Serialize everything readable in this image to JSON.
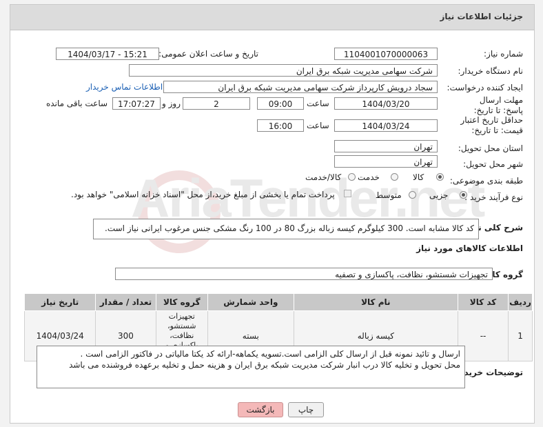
{
  "header": {
    "title": "جزئیات اطلاعات نیاز"
  },
  "watermark": "AriaTender.net",
  "fields": {
    "need_number_label": "شماره نیاز:",
    "need_number": "1104001070000063",
    "announce_label": "تاریخ و ساعت اعلان عمومی:",
    "announce_value": "1404/03/17 - 15:21",
    "buyer_org_label": "نام دستگاه خریدار:",
    "buyer_org": "شرکت سهامی مدیریت شبکه برق ایران",
    "creator_label": "ایجاد کننده درخواست:",
    "creator": "سجاد درویش کارپرداز شرکت سهامی مدیریت شبکه برق ایران",
    "contact_link": "اطلاعات تماس خریدار",
    "deadline_label": "مهلت ارسال پاسخ: تا تاریخ:",
    "deadline_date": "1404/03/20",
    "hour_label": "ساعت",
    "deadline_time": "09:00",
    "days_value": "2",
    "days_label": "روز و",
    "remaining_time": "17:07:27",
    "remaining_label": "ساعت باقی مانده",
    "price_valid_label": "حداقل تاریخ اعتبار قیمت: تا تاریخ:",
    "price_valid_date": "1404/03/24",
    "price_valid_time": "16:00",
    "province_label": "استان محل تحویل:",
    "province": "تهران",
    "city_label": "شهر محل تحویل:",
    "city": "تهران",
    "category_label": "طبقه بندی موضوعی:",
    "category_options": [
      "کالا",
      "خدمت",
      "کالا/خدمت"
    ],
    "process_label": "نوع فرآیند خرید :",
    "process_options": [
      "جزیی",
      "متوسط"
    ],
    "payment_note": "پرداخت تمام یا بخشی از مبلغ خرید،از محل \"اسناد خزانه اسلامی\" خواهد بود."
  },
  "summary": {
    "label": "شرح کلی نیاز:",
    "text": "کد کالا مشابه است. 300 کیلوگرم کیسه زباله بزرگ 80 در 100 رنگ مشکی جنس مرغوب ایرانی نیاز است."
  },
  "goods_section": {
    "title": "اطلاعات کالاهای مورد نیاز",
    "group_label": "گروه کالا:",
    "group_value": "تجهیزات شستشو، نظافت، پاکسازی و تصفیه"
  },
  "table": {
    "headers": [
      "ردیف",
      "کد کالا",
      "نام کالا",
      "واحد شمارش",
      "گروه کالا",
      "تعداد / مقدار",
      "تاریخ نیاز"
    ],
    "rows": [
      [
        "1",
        "--",
        "کیسه زباله",
        "بسته",
        "تجهیزات شستشو، نظافت، پاکسازی و تصفیه",
        "300",
        "1404/03/24"
      ]
    ]
  },
  "buyer_notes": {
    "label": "توضیحات خریدار:",
    "line1": "ارسال و تائید نمونه قبل از ارسال کلی الزامی است.تسویه یکماهه-ارائه کد یکتا مالیاتی در فاکتور الزامی است .",
    "line2": "محل تحویل و تخلیه کالا درب انبار شرکت مدیریت شبکه برق ایران  و هزینه حمل و تخلیه برعهده فروشنده می باشد"
  },
  "buttons": {
    "print": "چاپ",
    "back": "بازگشت"
  },
  "colors": {
    "link": "#1a5fb4",
    "back_button": "#f4b8b8",
    "header_bg": "#dcdcdc"
  }
}
